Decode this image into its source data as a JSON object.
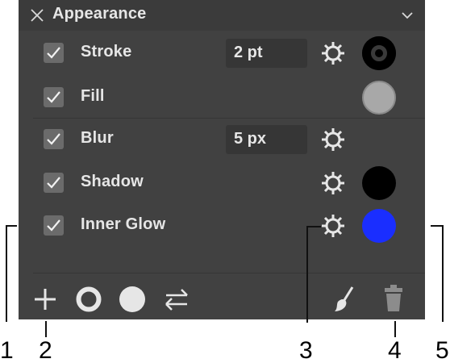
{
  "panel": {
    "title": "Appearance",
    "rows": [
      {
        "label": "Stroke",
        "value": "2 pt",
        "checked": true,
        "swatch": "#000000",
        "swatch_ring": "#333333"
      },
      {
        "label": "Fill",
        "value": "",
        "checked": true,
        "swatch": "#a8a8a8"
      },
      {
        "label": "Blur",
        "value": "5 px",
        "checked": true
      },
      {
        "label": "Shadow",
        "value": "",
        "checked": true,
        "swatch": "#000000"
      },
      {
        "label": "Inner Glow",
        "value": "",
        "checked": true,
        "swatch": "#1a2eff"
      }
    ]
  },
  "footer": {
    "icons": [
      "add-icon",
      "stroke-circle-icon",
      "fill-circle-icon",
      "swap-icon",
      "brush-icon",
      "trash-icon"
    ]
  },
  "callouts": [
    "1",
    "2",
    "3",
    "4",
    "5"
  ],
  "colors": {
    "panel_bg": "#414141",
    "header_bg": "#3b3b3b",
    "field_bg": "#363636",
    "checkbox_bg": "#6b6b6b",
    "text": "#e6e6e6",
    "glow_blue": "#1a2eff"
  }
}
